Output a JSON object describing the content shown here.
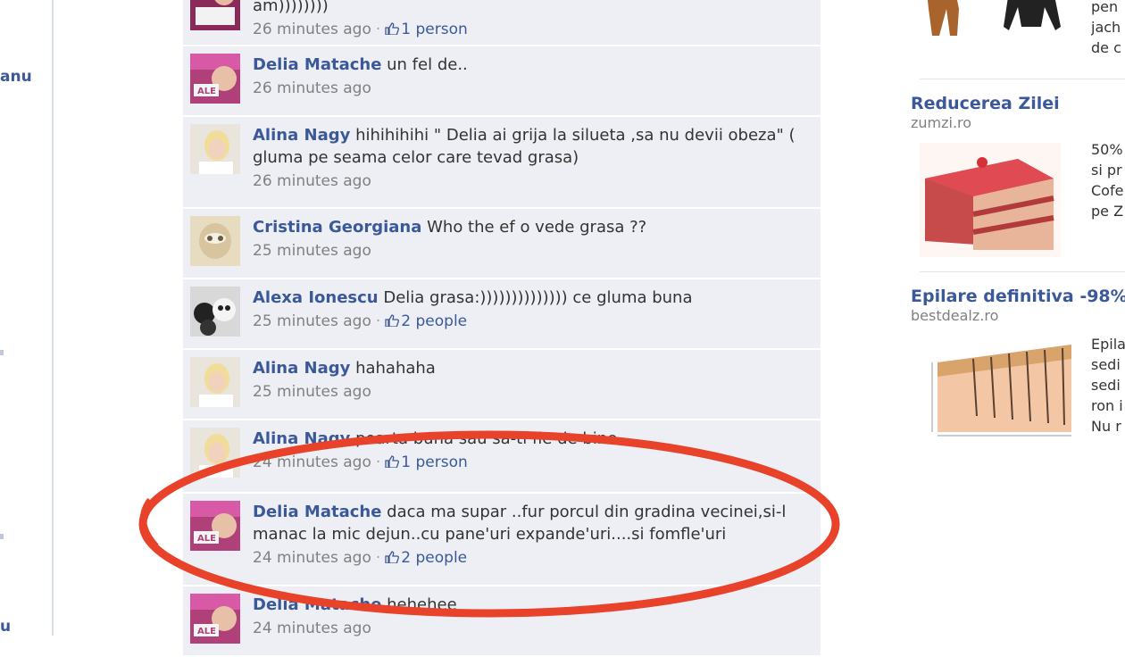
{
  "sidebar": {
    "fragments": [
      "anu",
      "u"
    ]
  },
  "comments": [
    {
      "author": "",
      "text": "am))))))))",
      "time": "26 minutes ago",
      "likes": "1 person"
    },
    {
      "author": "Delia Matache",
      "text": "un fel de..",
      "time": "26 minutes ago",
      "likes": ""
    },
    {
      "author": "Alina Nagy",
      "text": "hihihihihi \" Delia ai grija la silueta ,sa nu devii obeza\" ( gluma pe seama celor care tevad grasa)",
      "time": "26 minutes ago",
      "likes": ""
    },
    {
      "author": "Cristina Georgiana",
      "text": "Who the ef o vede grasa ??",
      "time": "25 minutes ago",
      "likes": ""
    },
    {
      "author": "Alexa Ionescu",
      "text": "Delia grasa:)))))))))))))) ce gluma buna",
      "time": "25 minutes ago",
      "likes": "2 people"
    },
    {
      "author": "Alina Nagy",
      "text": "hahahaha",
      "time": "25 minutes ago",
      "likes": ""
    },
    {
      "author": "Alina Nagy",
      "text": "poarta buna sau sa-ti fie de bine",
      "time": "24 minutes ago",
      "likes": "1 person"
    },
    {
      "author": "Delia Matache",
      "text": "daca ma supar ..fur porcul din gradina vecinei,si-l manac la mic dejun..cu pane'uri expande'uri....si fomfle'uri",
      "time": "24 minutes ago",
      "likes": "2 people"
    },
    {
      "author": "Delia Matache",
      "text": "hehehee",
      "time": "24 minutes ago",
      "likes": ""
    }
  ],
  "ads": [
    {
      "title": "",
      "domain": "",
      "text_lines": [
        "pen",
        "jach",
        "de c"
      ]
    },
    {
      "title": "Reducerea Zilei",
      "domain": "zumzi.ro",
      "text_lines": [
        "50%",
        "si pr",
        "Cofe",
        "pe Z"
      ]
    },
    {
      "title": "Epilare definitiva -98%",
      "domain": "bestdealz.ro",
      "text_lines": [
        "Epila",
        "sedi",
        "sedi",
        "ron i",
        "Nu r"
      ]
    }
  ],
  "colors": {
    "link": "#3b5998",
    "comment_bg": "#edeff4",
    "highlight": "#e8432a"
  }
}
